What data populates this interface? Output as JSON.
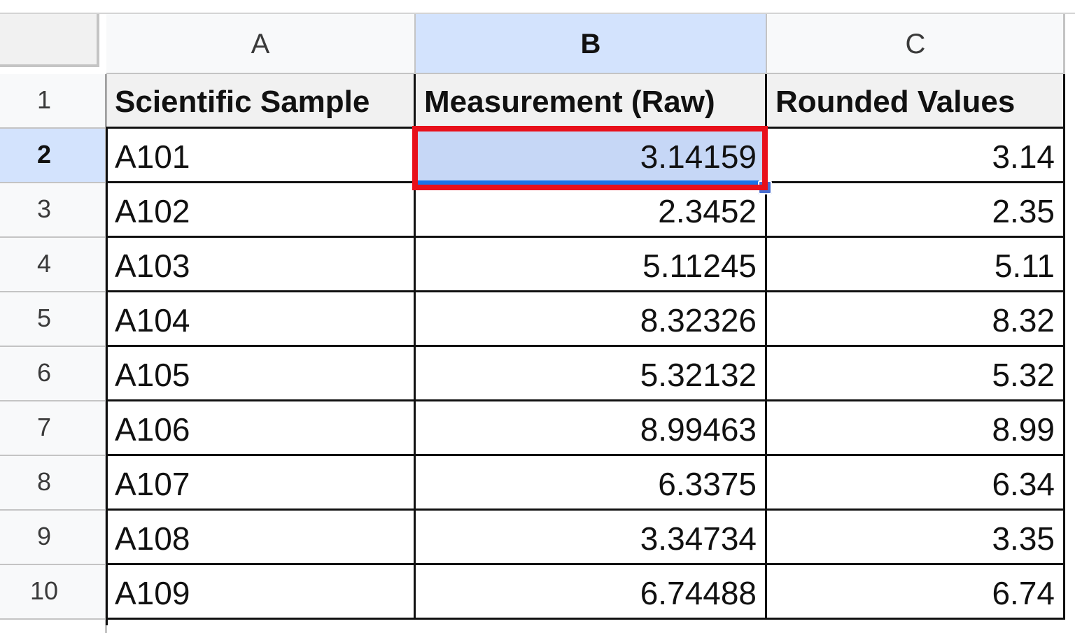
{
  "columns": [
    "A",
    "B",
    "C"
  ],
  "selected_column": "B",
  "selected_row": "2",
  "active_cell": "B2",
  "row_numbers": [
    "1",
    "2",
    "3",
    "4",
    "5",
    "6",
    "7",
    "8",
    "9",
    "10"
  ],
  "header": {
    "col_a": "Scientific Sample",
    "col_b": "Measurement (Raw)",
    "col_c": "Rounded Values"
  },
  "rows": [
    {
      "sample": "A101",
      "raw": "3.14159",
      "rounded": "3.14"
    },
    {
      "sample": "A102",
      "raw": "2.3452",
      "rounded": "2.35"
    },
    {
      "sample": "A103",
      "raw": "5.11245",
      "rounded": "5.11"
    },
    {
      "sample": "A104",
      "raw": "8.32326",
      "rounded": "8.32"
    },
    {
      "sample": "A105",
      "raw": "5.32132",
      "rounded": "5.32"
    },
    {
      "sample": "A106",
      "raw": "8.99463",
      "rounded": "8.99"
    },
    {
      "sample": "A107",
      "raw": "6.3375",
      "rounded": "6.34"
    },
    {
      "sample": "A108",
      "raw": "3.34734",
      "rounded": "3.35"
    },
    {
      "sample": "A109",
      "raw": "6.74488",
      "rounded": "6.74"
    }
  ],
  "colors": {
    "selection_fill": "#c6d7f6",
    "header_selected": "#d3e3fd",
    "highlight_border": "#e8101b",
    "selection_border": "#1a73e8"
  }
}
